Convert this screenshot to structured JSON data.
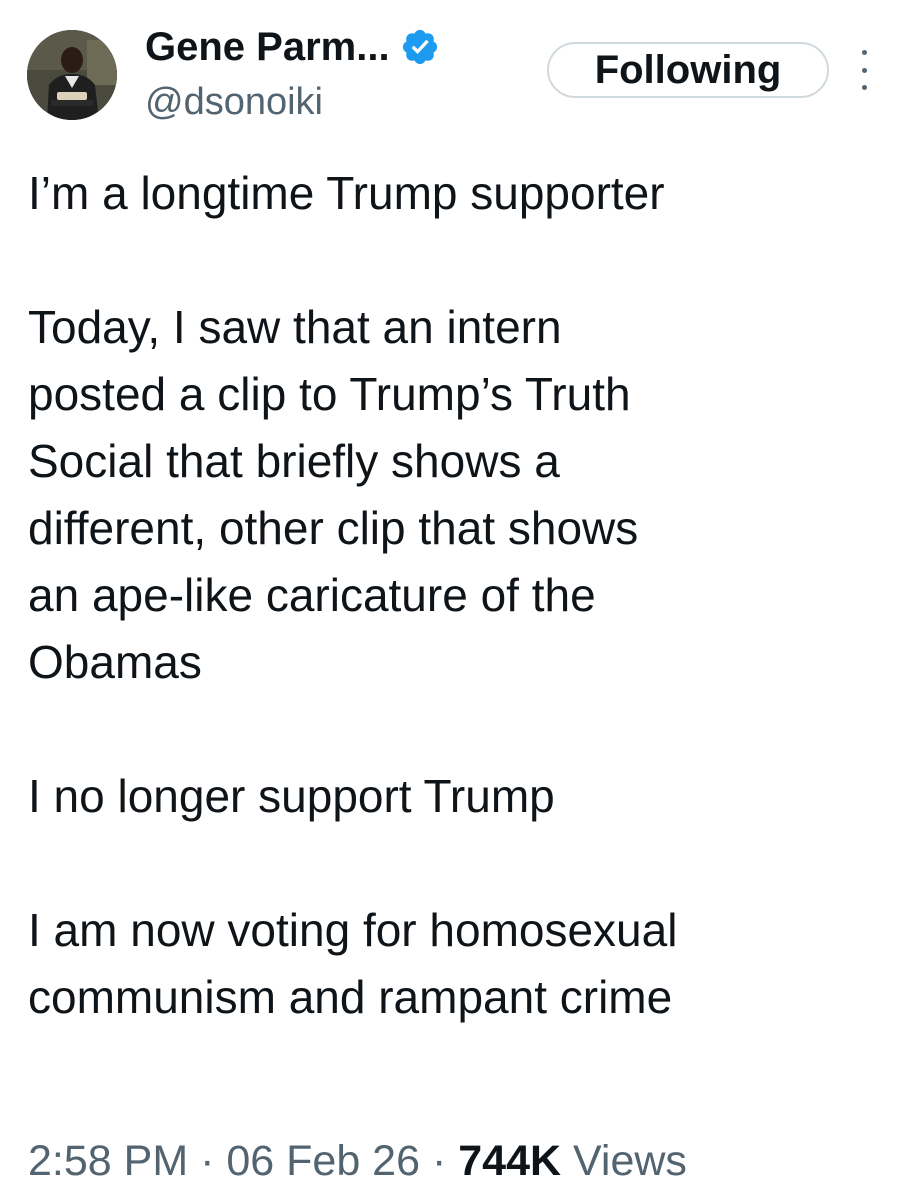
{
  "author": {
    "display_name": "Gene Parm...",
    "handle": "@dsonoiki",
    "avatar_icon": "profile-photo",
    "verified_icon": "verified-badge-icon",
    "verified_color": "#1d9bf0"
  },
  "actions": {
    "follow_label": "Following",
    "more_icon": "more-options-icon"
  },
  "tweet": {
    "paragraphs": [
      "I’m a longtime Trump supporter",
      "Today, I saw that an intern\nposted a clip to Trump’s Truth\nSocial that briefly shows a\ndifferent, other clip that shows\nan ape-like caricature of the\nObamas",
      "I no longer support Trump",
      "I am now voting for homosexual\ncommunism and rampant crime"
    ]
  },
  "meta": {
    "time": "2:58 PM",
    "separator": " · ",
    "date": "06 Feb 26",
    "views_count": "744K",
    "views_label": "Views"
  },
  "colors": {
    "text": "#0f1419",
    "secondary": "#536471",
    "button_border": "#cfd9de"
  }
}
